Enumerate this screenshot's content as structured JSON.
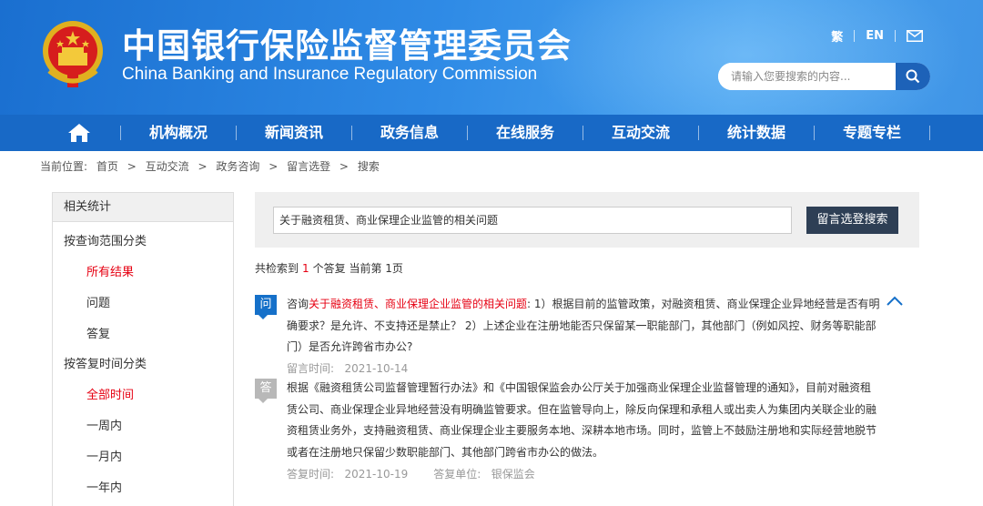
{
  "header": {
    "title_cn": "中国银行保险监督管理委员会",
    "title_en": "China Banking and Insurance Regulatory Commission",
    "links": {
      "traditional": "繁",
      "english": "EN"
    },
    "search_placeholder": "请输入您要搜索的内容...",
    "icons": [
      "emblem-icon",
      "mail-icon",
      "search-icon"
    ]
  },
  "nav": {
    "items": [
      "机构概况",
      "新闻资讯",
      "政务信息",
      "在线服务",
      "互动交流",
      "统计数据",
      "专题专栏"
    ],
    "home_icon": "home-icon"
  },
  "breadcrumb": {
    "label": "当前位置:",
    "items": [
      "首页",
      "互动交流",
      "政务咨询",
      "留言选登",
      "搜索"
    ],
    "separator": ">"
  },
  "sidebar": {
    "heading": "相关统计",
    "group1": "按查询范围分类",
    "group1_items": [
      "所有结果",
      "问题",
      "答复"
    ],
    "group2": "按答复时间分类",
    "group2_items": [
      "全部时间",
      "一周内",
      "一月内",
      "一年内"
    ]
  },
  "search": {
    "query": "关于融资租赁、商业保理企业监管的相关问题",
    "button": "留言选登搜索"
  },
  "results": {
    "prefix": "共检索到",
    "count": "1",
    "suffix": "个答复 当前第 1页"
  },
  "qa": {
    "q_badge": "问",
    "a_badge": "答",
    "q_prefix": "咨询",
    "q_highlight": "关于融资租赁、商业保理企业监管的相关问题",
    "q_text": ": 1）根据目前的监管政策，对融资租赁、商业保理企业异地经营是否有明确要求？是允许、不支持还是禁止？ 2）上述企业在注册地能否只保留某一职能部门，其他部门（例如风控、财务等职能部门）是否允许跨省市办公?",
    "q_time_label": "留言时间:",
    "q_time": "2021-10-14",
    "a_text": "根据《融资租赁公司监督管理暂行办法》和《中国银保监会办公厅关于加强商业保理企业监督管理的通知》，目前对融资租赁公司、商业保理企业异地经营没有明确监管要求。但在监管导向上，除反向保理和承租人或出卖人为集团内关联企业的融资租赁业务外，支持融资租赁、商业保理企业主要服务本地、深耕本地市场。同时，监管上不鼓励注册地和实际经营地脱节或者在注册地只保留少数职能部门、其他部门跨省市办公的做法。",
    "a_time_label": "答复时间:",
    "a_time": "2021-10-19",
    "a_unit_label": "答复单位:",
    "a_unit": "银保监会"
  },
  "colors": {
    "header_blue": "#2f8be6",
    "nav_blue": "#1869c6",
    "accent_red": "#e60012",
    "button_dark": "#2e3f55"
  }
}
